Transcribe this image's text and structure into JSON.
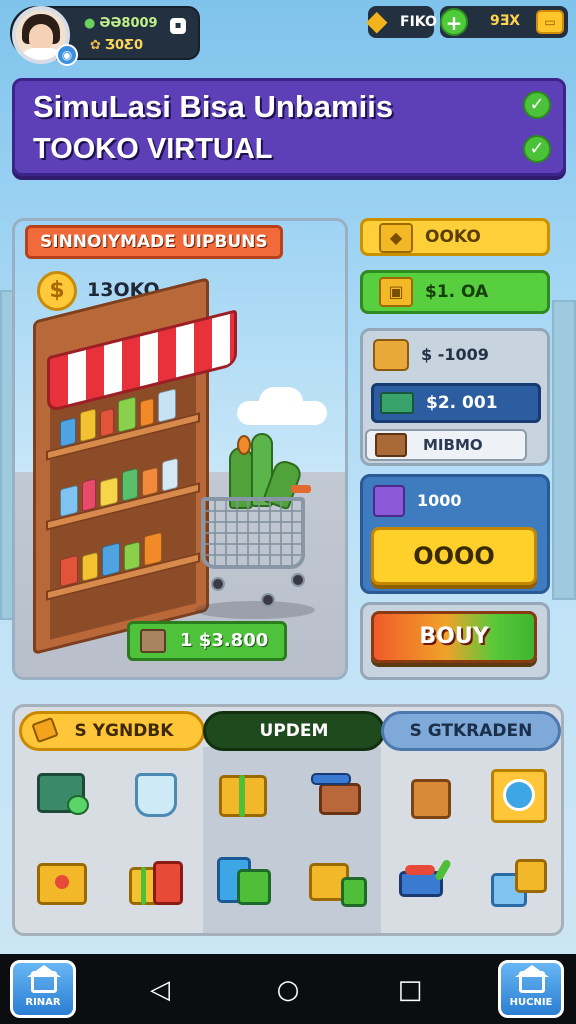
{
  "profile": {
    "line1": "ƏƏ8009",
    "line2": "Ʒ0Ƹ0",
    "badge_icon": "game-controller-icon",
    "settings_icon": "gear-icon"
  },
  "resources": {
    "gold_label": "FIKO",
    "gold_icon": "gold-bar-icon",
    "gems_value": "9ƎX",
    "add_icon": "plus-icon",
    "menu_icon": "ticket-icon"
  },
  "banner": {
    "title": "SimuLasi Bisa Unbamiis",
    "subtitle": "TOOKO VIRTUAL",
    "check_glyph": "✓"
  },
  "scene": {
    "title": "SINNOIYMADE UIPBUNS",
    "coin_glyph": "$",
    "coin_value": "13OKO",
    "price": "1 $3.800"
  },
  "side": {
    "yellow_button": "OOKO",
    "green_button": "$1. OA",
    "row1_value": "$ -1009",
    "row2_value": "$2. 001",
    "row3_value": "MIBMO",
    "row4_value": "1000",
    "big_yellow": "OOOO",
    "big_action": "BOUY"
  },
  "grid": {
    "tabs": [
      "S YGNDBK",
      "UPDEM",
      "S GTKRADEN"
    ],
    "items": [
      "cash-register-icon",
      "bucket-icon",
      "gift-box-icon",
      "coffee-cart-icon",
      "paper-bag-icon",
      "target-badge-icon",
      "gold-chest-icon",
      "gift-stack-icon",
      "book-stack-icon",
      "box-bundle-icon",
      "toy-cart-icon",
      "crate-pile-icon"
    ]
  },
  "navbar": {
    "left_label": "RINAR",
    "right_label": "HUCNIE",
    "back_glyph": "◁",
    "home_glyph": "○",
    "recent_glyph": "□"
  },
  "colors": {
    "banner": "#5d3fb8",
    "accent_yellow": "#ffcf3a",
    "accent_green": "#57cf3f",
    "accent_orange": "#f06a3a"
  }
}
